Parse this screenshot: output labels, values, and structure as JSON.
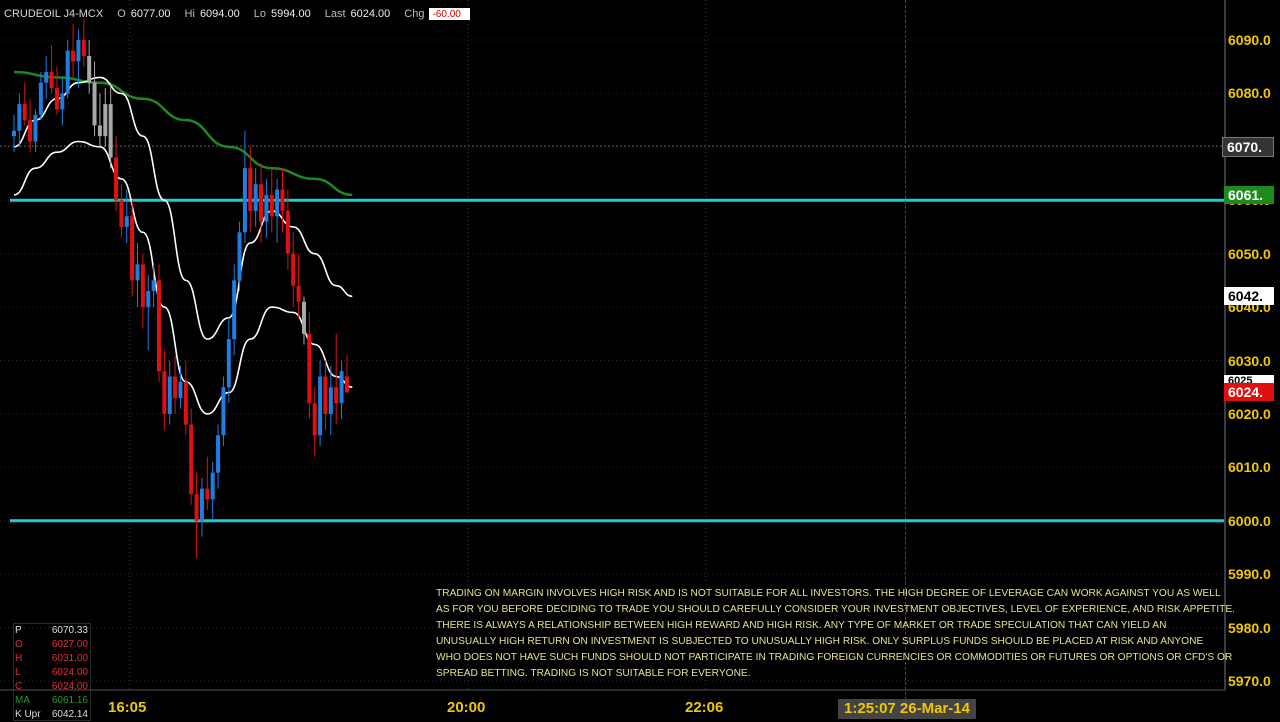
{
  "header": {
    "symbol": "CRUDEOIL J4-MCX",
    "open_label": "O",
    "open": "6077.00",
    "high_label": "Hi",
    "high": "6094.00",
    "low_label": "Lo",
    "low": "5994.00",
    "last_label": "Last",
    "last": "6024.00",
    "chg_label": "Chg",
    "chg": "-60.00"
  },
  "y_axis": [
    "6090.0",
    "6080.0",
    "6070.0",
    "6060.0",
    "6050.0",
    "6040.0",
    "6030.0",
    "6020.0",
    "6010.0",
    "6000.0",
    "5990.0",
    "5980.0",
    "5970.0"
  ],
  "x_axis": [
    "16:05",
    "20:00",
    "22:06"
  ],
  "time_stamp": "1:25:07 26-Mar-14",
  "price_tags": {
    "cursor": "6070.",
    "ma": "6061.",
    "upper": "6042.",
    "last": "6024.",
    "last_hidden": "6025"
  },
  "ohlc_panel": [
    {
      "k": "P",
      "v": "6070.33",
      "c": "#dddddd"
    },
    {
      "k": "O",
      "v": "6027.00",
      "c": "#e03030"
    },
    {
      "k": "H",
      "v": "6031.00",
      "c": "#e03030"
    },
    {
      "k": "L",
      "v": "6024.00",
      "c": "#e03030"
    },
    {
      "k": "C",
      "v": "6024.00",
      "c": "#e03030"
    },
    {
      "k": "MA",
      "v": "6061.16",
      "c": "#2a9a2a"
    },
    {
      "k": "K Upr",
      "v": "6042.14",
      "c": "#dddddd"
    }
  ],
  "disclaimer": [
    "TRADING ON MARGIN INVOLVES HIGH RISK AND IS NOT SUITABLE FOR ALL INVESTORS. THE HIGH DEGREE OF LEVERAGE CAN WORK AGAINST YOU AS WELL",
    "AS FOR YOU BEFORE DECIDING TO TRADE YOU SHOULD CAREFULLY CONSIDER YOUR INVESTMENT OBJECTIVES, LEVEL OF EXPERIENCE, AND RISK APPETITE.",
    "THERE IS ALWAYS A RELATIONSHIP BETWEEN HIGH REWARD AND HIGH RISK. ANY TYPE OF MARKET OR TRADE SPECULATION THAT CAN YIELD AN",
    "UNUSUALLY HIGH RETURN ON INVESTMENT IS SUBJECTED TO UNUSUALLY HIGH RISK. ONLY SURPLUS FUNDS SHOULD BE PLACED AT RISK AND ANYONE",
    "WHO DOES NOT HAVE SUCH FUNDS SHOULD NOT PARTICIPATE IN TRADING FOREIGN CURRENCIES OR COMMODITIES OR FUTURES OR OPTIONS OR CFD'S OR",
    "SPREAD BETTING. TRADING IS NOT SUITABLE FOR EVERYONE."
  ],
  "colors": {
    "up": "#1e7fe0",
    "down": "#e01010",
    "neutral": "#a8a8a8",
    "ma": "#1e8a1e",
    "band": "#ffffff",
    "hline": "#22cccc",
    "axis_text": "#f0c800"
  },
  "chart_data": {
    "type": "candlestick",
    "title": "",
    "ylim": [
      5968,
      6097
    ],
    "hlines": [
      6060,
      6000
    ],
    "candles": [
      [
        6072,
        6076,
        6069,
        6073
      ],
      [
        6073,
        6080,
        6070,
        6078
      ],
      [
        6078,
        6082,
        6074,
        6075
      ],
      [
        6075,
        6079,
        6069,
        6071
      ],
      [
        6071,
        6077,
        6069,
        6076
      ],
      [
        6076,
        6084,
        6075,
        6082
      ],
      [
        6082,
        6087,
        6079,
        6084
      ],
      [
        6084,
        6089,
        6080,
        6081
      ],
      [
        6081,
        6085,
        6076,
        6077
      ],
      [
        6077,
        6083,
        6074,
        6080
      ],
      [
        6080,
        6090,
        6079,
        6088
      ],
      [
        6088,
        6093,
        6083,
        6086
      ],
      [
        6086,
        6092,
        6081,
        6090
      ],
      [
        6090,
        6094,
        6085,
        6087
      ],
      [
        6087,
        6090,
        6080,
        6082
      ],
      [
        6082,
        6086,
        6072,
        6074
      ],
      [
        6074,
        6080,
        6070,
        6072
      ],
      [
        6072,
        6081,
        6070,
        6078
      ],
      [
        6078,
        6082,
        6066,
        6068
      ],
      [
        6068,
        6072,
        6058,
        6060
      ],
      [
        6060,
        6063,
        6053,
        6055
      ],
      [
        6055,
        6062,
        6052,
        6057
      ],
      [
        6057,
        6060,
        6042,
        6045
      ],
      [
        6045,
        6052,
        6040,
        6048
      ],
      [
        6048,
        6050,
        6036,
        6040
      ],
      [
        6040,
        6046,
        6032,
        6043
      ],
      [
        6043,
        6048,
        6040,
        6045
      ],
      [
        6045,
        6048,
        6026,
        6028
      ],
      [
        6028,
        6032,
        6017,
        6020
      ],
      [
        6020,
        6030,
        6018,
        6027
      ],
      [
        6027,
        6031,
        6020,
        6023
      ],
      [
        6023,
        6029,
        6021,
        6026
      ],
      [
        6026,
        6030,
        6016,
        6018
      ],
      [
        6018,
        6021,
        6003,
        6005
      ],
      [
        6005,
        6009,
        5993,
        6000
      ],
      [
        6000,
        6008,
        5997,
        6006
      ],
      [
        6006,
        6012,
        6002,
        6004
      ],
      [
        6004,
        6011,
        6000,
        6009
      ],
      [
        6009,
        6018,
        6006,
        6016
      ],
      [
        6016,
        6027,
        6014,
        6025
      ],
      [
        6025,
        6038,
        6022,
        6034
      ],
      [
        6034,
        6048,
        6031,
        6045
      ],
      [
        6045,
        6056,
        6043,
        6054
      ],
      [
        6054,
        6073,
        6052,
        6066
      ],
      [
        6066,
        6070,
        6054,
        6058
      ],
      [
        6058,
        6066,
        6055,
        6063
      ],
      [
        6063,
        6067,
        6052,
        6056
      ],
      [
        6056,
        6064,
        6053,
        6061
      ],
      [
        6061,
        6066,
        6054,
        6057
      ],
      [
        6057,
        6064,
        6052,
        6062
      ],
      [
        6062,
        6066,
        6054,
        6058
      ],
      [
        6058,
        6062,
        6047,
        6050
      ],
      [
        6050,
        6054,
        6040,
        6044
      ],
      [
        6044,
        6050,
        6038,
        6041
      ],
      [
        6041,
        6042,
        6033,
        6035
      ],
      [
        6035,
        6039,
        6019,
        6022
      ],
      [
        6022,
        6025,
        6012,
        6016
      ],
      [
        6016,
        6030,
        6014,
        6027
      ],
      [
        6027,
        6030,
        6017,
        6020
      ],
      [
        6020,
        6029,
        6016,
        6025
      ],
      [
        6025,
        6035,
        6018,
        6022
      ],
      [
        6022,
        6030,
        6019,
        6028
      ],
      [
        6027,
        6031,
        6024,
        6024
      ]
    ],
    "overlays": [
      {
        "name": "MA",
        "color": "#1e8a1e",
        "points": [
          [
            0,
            6084
          ],
          [
            8,
            6083
          ],
          [
            16,
            6082
          ],
          [
            24,
            6079
          ],
          [
            32,
            6075
          ],
          [
            40,
            6070
          ],
          [
            48,
            6066
          ],
          [
            56,
            6064
          ],
          [
            63,
            6061
          ]
        ]
      },
      {
        "name": "K Upr",
        "color": "#ffffff",
        "points": [
          [
            0,
            6070
          ],
          [
            4,
            6075
          ],
          [
            8,
            6079
          ],
          [
            12,
            6082
          ],
          [
            16,
            6083
          ],
          [
            20,
            6080
          ],
          [
            24,
            6072
          ],
          [
            28,
            6060
          ],
          [
            32,
            6045
          ],
          [
            36,
            6034
          ],
          [
            40,
            6038
          ],
          [
            44,
            6052
          ],
          [
            48,
            6058
          ],
          [
            52,
            6055
          ],
          [
            56,
            6050
          ],
          [
            60,
            6044
          ],
          [
            63,
            6042
          ]
        ]
      },
      {
        "name": "K Lwr",
        "color": "#ffffff",
        "points": [
          [
            0,
            6061
          ],
          [
            4,
            6066
          ],
          [
            8,
            6069
          ],
          [
            12,
            6071
          ],
          [
            16,
            6070
          ],
          [
            20,
            6064
          ],
          [
            24,
            6054
          ],
          [
            28,
            6040
          ],
          [
            32,
            6026
          ],
          [
            36,
            6020
          ],
          [
            40,
            6024
          ],
          [
            44,
            6034
          ],
          [
            48,
            6040
          ],
          [
            52,
            6039
          ],
          [
            56,
            6033
          ],
          [
            60,
            6027
          ],
          [
            63,
            6025
          ]
        ]
      }
    ]
  }
}
